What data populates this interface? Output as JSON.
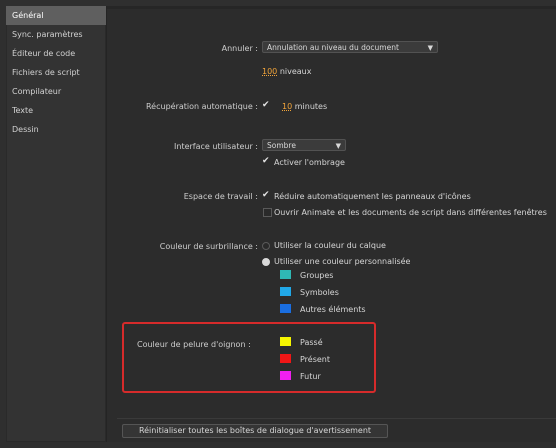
{
  "sidebar": {
    "items": [
      {
        "label": "Général",
        "active": true
      },
      {
        "label": "Sync. paramètres"
      },
      {
        "label": "Éditeur de code"
      },
      {
        "label": "Fichiers de script"
      },
      {
        "label": "Compilateur"
      },
      {
        "label": "Texte"
      },
      {
        "label": "Dessin"
      }
    ]
  },
  "general": {
    "annuler": {
      "label": "Annuler :",
      "value": "Annulation au niveau du document",
      "levels": "100",
      "levels_label": "niveaux"
    },
    "recuperation": {
      "label": "Récupération automatique :",
      "minutes": "10",
      "minutes_label": "minutes"
    },
    "interface": {
      "label": "Interface utilisateur :",
      "value": "Sombre",
      "shading_label": "Activer l'ombrage"
    },
    "workspace": {
      "label": "Espace de travail :",
      "option1": "Réduire automatiquement les panneaux d'icônes",
      "option2": "Ouvrir Animate et les documents de script dans différentes fenêtres"
    },
    "highlight": {
      "label": "Couleur de surbrillance :",
      "option1": "Utiliser la couleur du calque",
      "option2": "Utiliser une couleur personnalisée",
      "colors": [
        {
          "label": "Groupes",
          "color": "#2fb8b4"
        },
        {
          "label": "Symboles",
          "color": "#21a8e8"
        },
        {
          "label": "Autres éléments",
          "color": "#1a6ee0"
        }
      ]
    },
    "onion": {
      "label": "Couleur de pelure d'oignon :",
      "colors": [
        {
          "label": "Passé",
          "color": "#f5f500"
        },
        {
          "label": "Présent",
          "color": "#f01616"
        },
        {
          "label": "Futur",
          "color": "#f01ff0"
        }
      ]
    },
    "reset_button": "Réinitialiser toutes les boîtes de dialogue d'avertissement"
  }
}
